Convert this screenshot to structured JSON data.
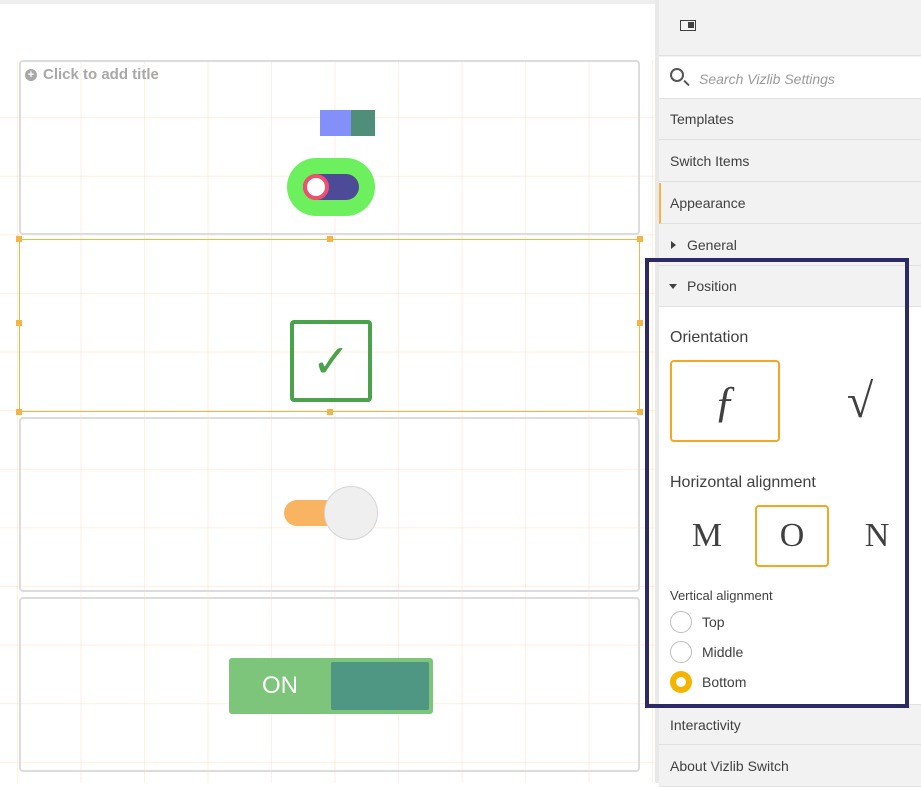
{
  "canvas": {
    "add_title": "Click to add title",
    "colors": {
      "toggle_bg": "#6cf05d",
      "toggle_track": "#4d4a98",
      "toggle_knob_ring": "#f04f6f",
      "checkbox": "#4aa34a",
      "orange_track": "#f9b462",
      "on_switch_bg": "#7cc57a",
      "on_switch_thumb": "#4f9683",
      "selection": "#f5b445"
    },
    "on_switch": {
      "label": "ON"
    },
    "checkbox": {
      "glyph": "✓"
    }
  },
  "sidebar": {
    "search": {
      "placeholder": "Search Vizlib Settings"
    },
    "nav": {
      "templates": "Templates",
      "switch_items": "Switch Items",
      "appearance": "Appearance",
      "general": "General",
      "position": "Position",
      "interactivity": "Interactivity",
      "about": "About Vizlib Switch"
    },
    "position": {
      "orientation_label": "Orientation",
      "orientation_options": [
        "ƒ",
        "√"
      ],
      "horizontal_label": "Horizontal alignment",
      "horizontal_options": [
        "M",
        "O",
        "N"
      ],
      "vertical_label": "Vertical alignment",
      "vertical_options": [
        "Top",
        "Middle",
        "Bottom"
      ],
      "vertical_selected": "Bottom"
    }
  }
}
